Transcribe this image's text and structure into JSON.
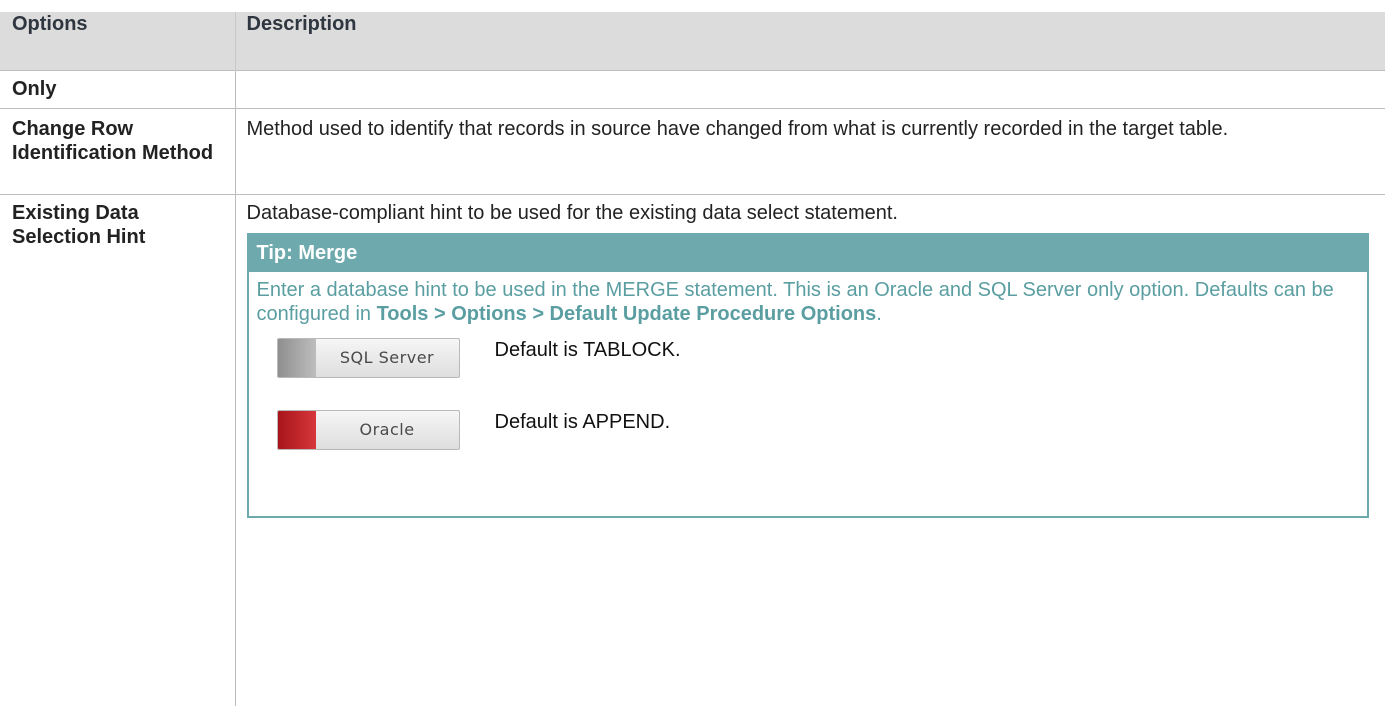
{
  "table": {
    "headers": {
      "options": "Options",
      "description": "Description"
    },
    "rows": [
      {
        "option": "Only",
        "description": ""
      },
      {
        "option": "Change Row Identification Method",
        "description": "Method used to identify that records in source have changed from what is currently recorded in the target table."
      },
      {
        "option": "Existing Data Selection Hint",
        "description": "Database-compliant hint to be used for the existing data select statement."
      }
    ]
  },
  "tip": {
    "title": "Tip: Merge",
    "text_before": " Enter a database hint to be used in the MERGE statement. This is an Oracle and SQL Server only option. Defaults can be configured in ",
    "bold_path": "Tools > Options > Default Update Procedure Options",
    "text_after": ".",
    "databases": [
      {
        "label": "SQL Server",
        "note": "Default is TABLOCK.",
        "color": "#9e9e9e"
      },
      {
        "label": "Oracle",
        "note": "Default is APPEND.",
        "color": "#c0242a"
      }
    ]
  },
  "colors": {
    "tip_accent": "#6eaaad",
    "header_bg": "#dcdcdc"
  }
}
